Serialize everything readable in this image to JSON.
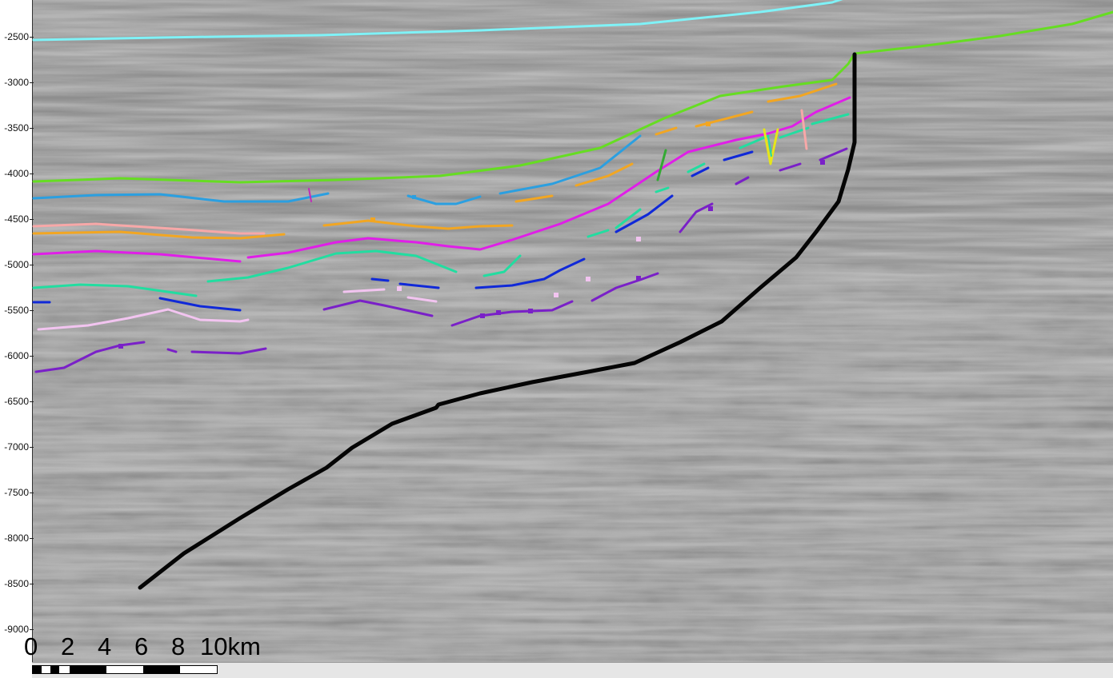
{
  "depth_axis": {
    "labels": [
      "-2500",
      "-3000",
      "-3500",
      "-4000",
      "-4500",
      "-5000",
      "-5500",
      "-6000",
      "-6500",
      "-7000",
      "-7500",
      "-8000",
      "-8500",
      "-9000"
    ]
  },
  "scale": {
    "numbers": [
      "0",
      "2",
      "4",
      "6",
      "8",
      "10km"
    ]
  },
  "colors": {
    "cyan": "#7ff2f7",
    "lime": "#66dd22",
    "blue": "#2b9fe0",
    "orange": "#f2a622",
    "pink": "#f7a8a8",
    "magenta": "#e01ee8",
    "teal": "#22dda0",
    "navy": "#1029d8",
    "lilac": "#f2c4f0",
    "purple": "#7a20c8",
    "fault": "#050505"
  }
}
